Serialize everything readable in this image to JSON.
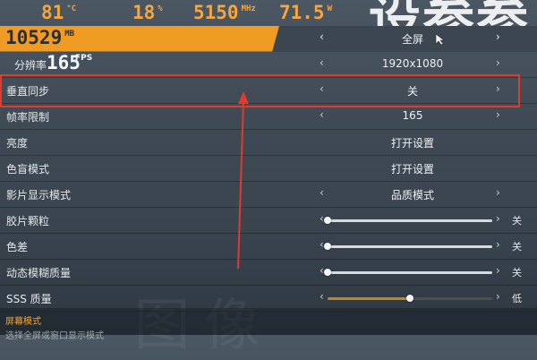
{
  "background_title": "设参参",
  "background_glyph": "图像",
  "stats": {
    "temp": {
      "value": "81",
      "unit": "°C"
    },
    "usage": {
      "value": "18",
      "unit": "%"
    },
    "clock": {
      "value": "5150",
      "unit": "MHz"
    },
    "power": {
      "value": "71.5",
      "unit": "W"
    },
    "vram": {
      "value": "10529",
      "unit": "MB"
    },
    "fps": {
      "value": "165",
      "unit": "FPS"
    }
  },
  "settings": {
    "mode": {
      "label": "",
      "value": "全屏"
    },
    "resolution": {
      "label": "分辨率",
      "value": "1920x1080"
    },
    "vsync": {
      "label": "垂直同步",
      "value": "关"
    },
    "frame_limit": {
      "label": "帧率限制",
      "value": "165"
    },
    "brightness": {
      "label": "亮度",
      "value": "打开设置"
    },
    "colorblind": {
      "label": "色盲模式",
      "value": "打开设置"
    },
    "film_mode": {
      "label": "影片显示模式",
      "value": "品质模式"
    },
    "film_grain": {
      "label": "胶片颗粒",
      "value": "关",
      "level": 0
    },
    "chromatic": {
      "label": "色差",
      "value": "关",
      "level": 0
    },
    "motion_blur": {
      "label": "动态模糊质量",
      "value": "关",
      "level": 0
    },
    "sss": {
      "label": "SSS 质量",
      "value": "低",
      "level": 0.5
    }
  },
  "footer": {
    "title": "屏幕模式",
    "subtitle": "选择全屏或窗口显示模式"
  },
  "colors": {
    "accent": "#f09c24",
    "highlight_box": "#e23a2e",
    "stat_text": "#f6a640"
  },
  "icons": [
    "chevron-left-icon",
    "chevron-right-icon",
    "mouse-cursor-icon",
    "red-arrow-annotation"
  ]
}
